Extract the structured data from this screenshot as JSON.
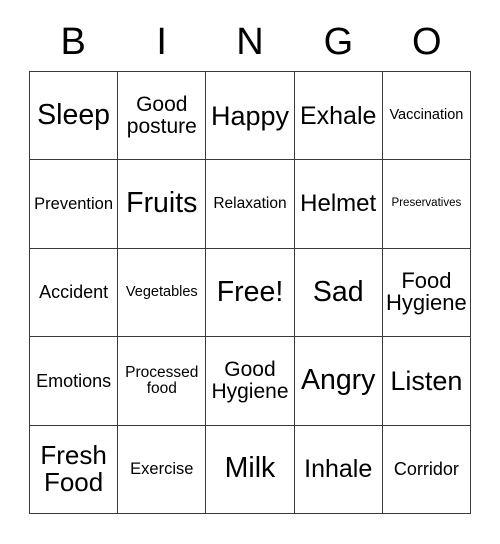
{
  "card": {
    "header_letters": [
      "B",
      "I",
      "N",
      "G",
      "O"
    ],
    "grid_size": 5,
    "free_space_label": "Free!",
    "rows": [
      [
        {
          "text": "Sleep",
          "size_class": "fs-28",
          "lines": 1
        },
        {
          "text": "Good\nposture",
          "size_class": "fs-21",
          "lines": 2
        },
        {
          "text": "Happy",
          "size_class": "fs-27",
          "lines": 1
        },
        {
          "text": "Exhale",
          "size_class": "fs-25",
          "lines": 1
        },
        {
          "text": "Vaccination",
          "size_class": "fs-14",
          "lines": 1
        }
      ],
      [
        {
          "text": "Prevention",
          "size_class": "fs-16",
          "lines": 1
        },
        {
          "text": "Fruits",
          "size_class": "fs-28",
          "lines": 1
        },
        {
          "text": "Relaxation",
          "size_class": "fs-15",
          "lines": 1
        },
        {
          "text": "Helmet",
          "size_class": "fs-24",
          "lines": 1
        },
        {
          "text": "Preservatives",
          "size_class": "fs-11",
          "lines": 1
        }
      ],
      [
        {
          "text": "Accident",
          "size_class": "fs-18",
          "lines": 1
        },
        {
          "text": "Vegetables",
          "size_class": "fs-14",
          "lines": 1
        },
        {
          "text": "Free!",
          "size_class": "fs-28",
          "lines": 1
        },
        {
          "text": "Sad",
          "size_class": "fs-28",
          "lines": 1
        },
        {
          "text": "Food\nHygiene",
          "size_class": "fs-22",
          "lines": 2
        }
      ],
      [
        {
          "text": "Emotions",
          "size_class": "fs-18",
          "lines": 1
        },
        {
          "text": "Processed\nfood",
          "size_class": "fs-15",
          "lines": 2
        },
        {
          "text": "Good\nHygiene",
          "size_class": "fs-21",
          "lines": 2
        },
        {
          "text": "Angry",
          "size_class": "fs-28",
          "lines": 1
        },
        {
          "text": "Listen",
          "size_class": "fs-27",
          "lines": 1
        }
      ],
      [
        {
          "text": "Fresh\nFood",
          "size_class": "fs-26",
          "lines": 2
        },
        {
          "text": "Exercise",
          "size_class": "fs-16",
          "lines": 1
        },
        {
          "text": "Milk",
          "size_class": "fs-28",
          "lines": 1
        },
        {
          "text": "Inhale",
          "size_class": "fs-25",
          "lines": 1
        },
        {
          "text": "Corridor",
          "size_class": "fs-18",
          "lines": 1
        }
      ]
    ]
  },
  "colors": {
    "background": "#ffffff",
    "text": "#000000",
    "grid_line": "#3a3a3a"
  }
}
